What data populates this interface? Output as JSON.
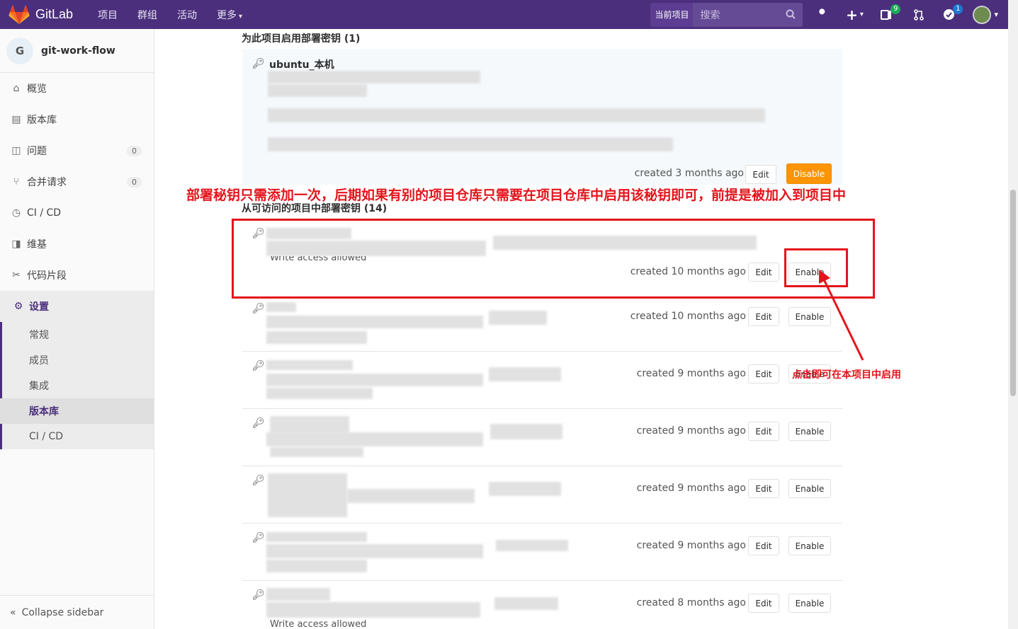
{
  "navbar": {
    "brand": "GitLab",
    "links": [
      "项目",
      "群组",
      "活动",
      "更多"
    ],
    "scope_label": "当前项目",
    "search_placeholder": "搜索",
    "issues_count": "9",
    "todos_count": "1",
    "bg_color": "#4b2f7d"
  },
  "sidebar": {
    "project_initial": "G",
    "project_name": "git-work-flow",
    "items": [
      {
        "label": "概览",
        "icon": "home-icon"
      },
      {
        "label": "版本库",
        "icon": "doc-icon"
      },
      {
        "label": "问题",
        "icon": "issues-icon",
        "count": "0"
      },
      {
        "label": "合并请求",
        "icon": "merge-icon",
        "count": "0"
      },
      {
        "label": "CI / CD",
        "icon": "rocket-icon"
      },
      {
        "label": "维基",
        "icon": "book-icon"
      },
      {
        "label": "代码片段",
        "icon": "scissors-icon"
      },
      {
        "label": "设置",
        "icon": "gear-icon"
      }
    ],
    "settings_sub": [
      "常规",
      "成员",
      "集成",
      "版本库",
      "CI / CD"
    ],
    "collapse_label": "Collapse sidebar"
  },
  "main": {
    "enabled_title": "为此项目启用部署密钥 (1)",
    "enabled_key": {
      "title": "ubuntu_本机",
      "created": "created 3 months ago",
      "edit": "Edit",
      "disable": "Disable"
    },
    "annotation_top": "部署秘钥只需添加一次，后期如果有别的项目仓库只需要在项目仓库中启用该秘钥即可，前提是被加入到项目中",
    "available_title": "从可访问的项目中部署密钥 (14)",
    "write_access": "Write access allowed",
    "annotation_side": "点击即可在本项目中启用",
    "keys": [
      {
        "created": "created 10 months ago",
        "edit": "Edit",
        "enable": "Enable"
      },
      {
        "created": "created 10 months ago",
        "edit": "Edit",
        "enable": "Enable"
      },
      {
        "created": "created 9 months ago",
        "edit": "Edit",
        "enable": "Enable"
      },
      {
        "created": "created 9 months ago",
        "edit": "Edit",
        "enable": "Enable"
      },
      {
        "created": "created 9 months ago",
        "edit": "Edit",
        "enable": "Enable"
      },
      {
        "created": "created 9 months ago",
        "edit": "Edit",
        "enable": "Enable"
      },
      {
        "created": "created 8 months ago",
        "edit": "Edit",
        "enable": "Enable"
      }
    ]
  }
}
